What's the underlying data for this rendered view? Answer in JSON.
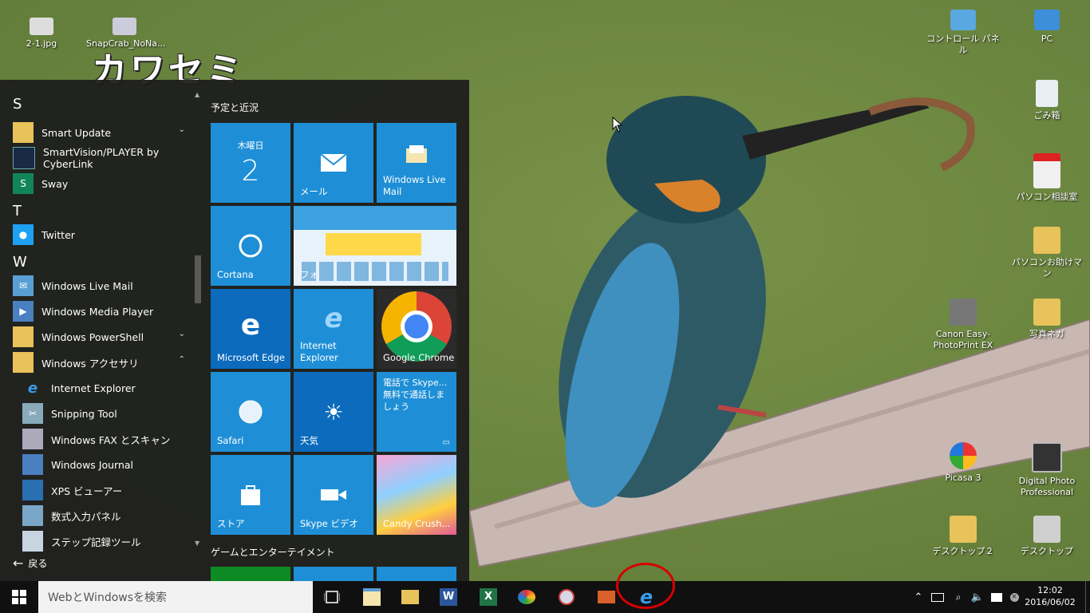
{
  "desktop": {
    "wallpaper_title": "カワセミ",
    "icons": [
      {
        "label": "2-1.jpg"
      },
      {
        "label": "SnapCrab_NoNa..."
      },
      {
        "label": "コントロール パネル"
      },
      {
        "label": "PC"
      },
      {
        "label": "ごみ箱"
      },
      {
        "label": "パソコン相談室"
      },
      {
        "label": "パソコンお助けマン"
      },
      {
        "label": "Canon Easy-PhotoPrint EX"
      },
      {
        "label": "写真ネガ"
      },
      {
        "label": "Picasa 3"
      },
      {
        "label": "Digital Photo Professional"
      },
      {
        "label": "デスクトップ２"
      },
      {
        "label": "デスクトップ"
      }
    ]
  },
  "start_menu": {
    "letters": {
      "s": "S",
      "t": "T",
      "w": "W"
    },
    "apps": [
      {
        "label": "Smart Update",
        "icon": "folder-icon"
      },
      {
        "label": "SmartVision/PLAYER by CyberLink",
        "icon": "smartvision-icon"
      },
      {
        "label": "Sway",
        "icon": "sway-icon"
      },
      {
        "label": "Twitter",
        "icon": "twitter-icon"
      },
      {
        "label": "Windows Live Mail",
        "icon": "live-mail-icon"
      },
      {
        "label": "Windows Media Player",
        "icon": "media-player-icon"
      },
      {
        "label": "Windows PowerShell",
        "icon": "folder-icon"
      },
      {
        "label": "Windows アクセサリ",
        "icon": "folder-icon"
      },
      {
        "label": "Internet Explorer",
        "icon": "internet-explorer-icon"
      },
      {
        "label": "Snipping Tool",
        "icon": "snipping-tool-icon"
      },
      {
        "label": "Windows FAX とスキャン",
        "icon": "fax-icon"
      },
      {
        "label": "Windows Journal",
        "icon": "journal-icon"
      },
      {
        "label": "XPS ビューアー",
        "icon": "xps-icon"
      },
      {
        "label": "数式入力パネル",
        "icon": "math-panel-icon"
      },
      {
        "label": "ステップ記録ツール",
        "icon": "steps-recorder-icon"
      }
    ],
    "back_label": "戻る",
    "groups": {
      "schedule": "予定と近況",
      "games": "ゲームとエンターテイメント"
    },
    "tiles": {
      "calendar_day": "木曜日",
      "calendar_date": "2",
      "mail": "メール",
      "live_mail": "Windows Live Mail",
      "cortana": "Cortana",
      "photo_caption": "フォ",
      "edge": "Microsoft Edge",
      "ie": "Internet Explorer",
      "chrome": "Google Chrome",
      "safari": "Safari",
      "weather": "天気",
      "skype_promo": "電話で Skype... 無料で通話しましょう",
      "store": "ストア",
      "skype_video": "Skype ビデオ",
      "candy": "Candy Crush..."
    }
  },
  "taskbar": {
    "search_placeholder": "WebとWindowsを検索",
    "time": "12:02",
    "date": "2016/06/02"
  },
  "colors": {
    "tile_blue": "#1e8fd6",
    "tile_dark_blue": "#0c6bbd",
    "green_tile": "#0e8a24",
    "annotation_red": "#d60000"
  }
}
